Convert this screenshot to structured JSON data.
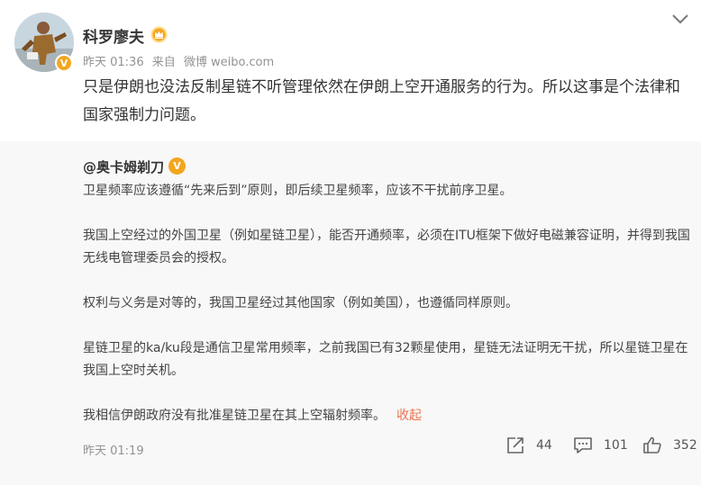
{
  "post": {
    "username": "科罗廖夫",
    "meta": {
      "time": "昨天 01:36",
      "source_prefix": "来自",
      "source": "微博 weibo.com"
    },
    "text": "只是伊朗也没法反制星链不听管理依然在伊朗上空开通服务的行为。所以这事是个法律和国家强制力问题。",
    "verified_badge": "V"
  },
  "repost": {
    "author": "@奥卡姆剃刀",
    "verified_badge": "V",
    "paragraphs": [
      "卫星频率应该遵循“先来后到”原则，即后续卫星频率，应该不干扰前序卫星。",
      "我国上空经过的外国卫星（例如星链卫星），能否开通频率，必须在ITU框架下做好电磁兼容证明，并得到我国无线电管理委员会的授权。",
      "权利与义务是对等的，我国卫星经过其他国家（例如美国），也遵循同样原则。",
      "星链卫星的ka/ku段是通信卫星常用频率，之前我国已有32颗星使用，星链无法证明无干扰，所以星链卫星在我国上空时关机。",
      "我相信伊朗政府没有批准星链卫星在其上空辐射频率。"
    ],
    "collapse_label": "收起",
    "time": "昨天 01:19",
    "actions": {
      "share_count": "44",
      "comment_count": "101",
      "like_count": "352"
    }
  },
  "colors": {
    "link_orange": "#eb7350",
    "meta_gray": "#939393",
    "repost_bg": "#f8f8f8",
    "badge_gold": "#f2a61f"
  },
  "icons": [
    "crown-badge-icon",
    "chevron-down-icon",
    "share-icon",
    "comment-icon",
    "like-icon"
  ]
}
